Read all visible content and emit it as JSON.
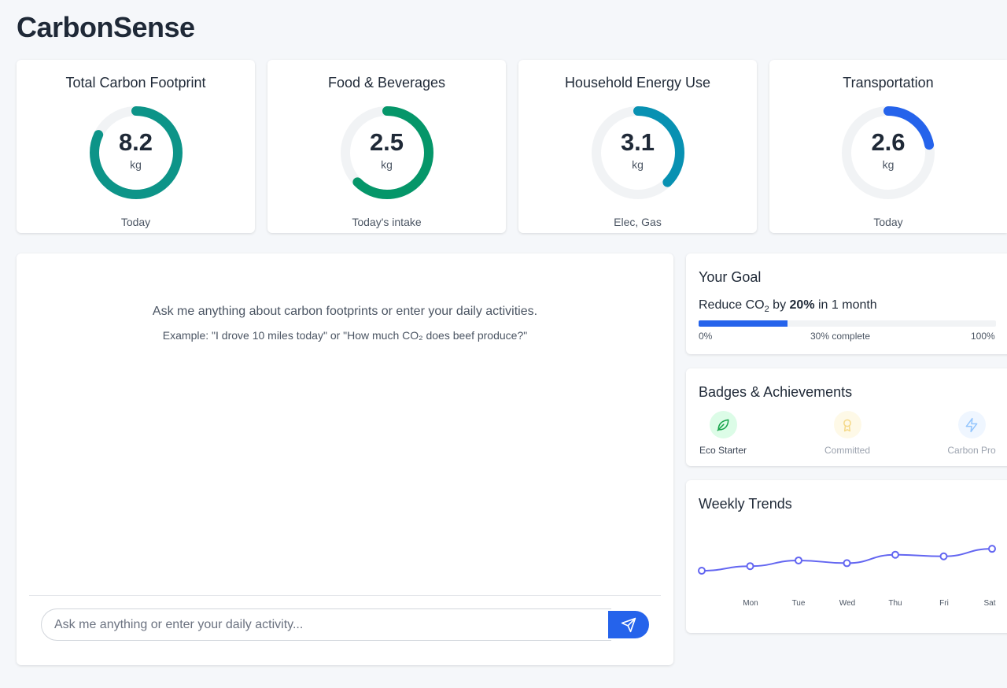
{
  "app": {
    "title": "CarbonSense"
  },
  "colors": {
    "accent": "#2563eb",
    "teal": "#0d9488",
    "green": "#059669",
    "cyan": "#0891b2",
    "track": "#f1f3f5"
  },
  "stats": [
    {
      "title": "Total Carbon Footprint",
      "value": "8.2",
      "unit": "kg",
      "sub": "Today",
      "fraction": 0.82,
      "color": "#0d9488"
    },
    {
      "title": "Food & Beverages",
      "value": "2.5",
      "unit": "kg",
      "sub": "Today's intake",
      "fraction": 0.625,
      "color": "#059669"
    },
    {
      "title": "Household Energy Use",
      "value": "3.1",
      "unit": "kg",
      "sub": "Elec, Gas",
      "fraction": 0.375,
      "color": "#0891b2"
    },
    {
      "title": "Transportation",
      "value": "2.6",
      "unit": "kg",
      "sub": "Today",
      "fraction": 0.22,
      "color": "#2563eb"
    }
  ],
  "chat": {
    "intro": "Ask me anything about carbon footprints or enter your daily activities.",
    "example": "Example: \"I drove 10 miles today\" or \"How much CO₂ does beef produce?\"",
    "input_placeholder": "Ask me anything or enter your daily activity...",
    "send_icon": "send-icon"
  },
  "goal": {
    "title": "Your Goal",
    "text_prefix": "Reduce CO",
    "text_sub": "2",
    "text_mid": " by ",
    "text_bold": "20%",
    "text_suffix": " in 1 month",
    "progress": 0.3,
    "label_start": "0%",
    "label_mid": "30% complete",
    "label_end": "100%"
  },
  "badges": {
    "title": "Badges & Achievements",
    "items": [
      {
        "label": "Eco Starter",
        "icon": "leaf-icon",
        "earned": true
      },
      {
        "label": "Committed",
        "icon": "award-icon",
        "earned": false
      },
      {
        "label": "Carbon Pro",
        "icon": "lightning-icon",
        "earned": false
      }
    ]
  },
  "trends": {
    "title": "Weekly Trends",
    "days": [
      "Mon",
      "Tue",
      "Wed",
      "Thu",
      "Fri",
      "Sat"
    ]
  },
  "chart_data": {
    "type": "line",
    "title": "Weekly Trends",
    "x": [
      "",
      "Mon",
      "Tue",
      "Wed",
      "Thu",
      "Fri",
      "Sat"
    ],
    "series": [
      {
        "values": [
          0.0,
          0.2,
          0.45,
          0.33,
          0.7,
          0.63,
          0.96
        ]
      }
    ],
    "ylim": [
      0,
      1
    ],
    "grid": false
  }
}
